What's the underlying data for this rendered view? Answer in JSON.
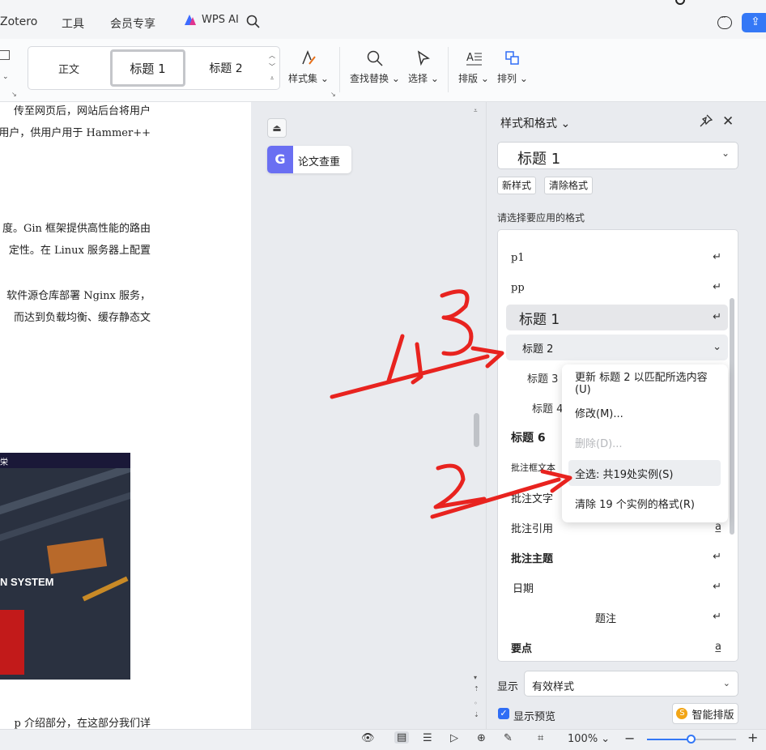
{
  "menubar": {
    "items": [
      "Zotero",
      "工具",
      "会员专享"
    ],
    "wps_ai": "WPS AI"
  },
  "ribbon": {
    "gallery": [
      "正文",
      "标题 1",
      "标题 2"
    ],
    "style_set": "样式集",
    "find_replace": "查找替换",
    "select": "选择",
    "layout": "排版",
    "arrange": "排列"
  },
  "document": {
    "lines": [
      "传至网页后，网站后台将用户",
      "用户，供用户用于 Hammer++",
      "度。Gin 框架提供高性能的路由",
      "定性。在 Linux 服务器上配置",
      "软件源仓库部署 Nginx 服务，",
      "而达到负载均衡、缓存静态文",
      "p 介绍部分，在这部分我们详"
    ],
    "image_top_text": "栄",
    "image_text": "N SYSTEM"
  },
  "plugin": {
    "chachong": "论文查重"
  },
  "panel": {
    "title": "样式和格式",
    "current_style": "标题 1",
    "new_style": "新样式",
    "clear_format": "清除格式",
    "hint": "请选择要应用的格式",
    "styles": [
      "p1",
      "pp",
      "标题 1",
      "标题 2",
      "标题 3",
      "标题 4",
      "标题 6",
      "批注框文本",
      "批注文字",
      "批注引用",
      "批注主题",
      "日期",
      "题注",
      "要点"
    ],
    "display_label": "显示",
    "display_value": "有效样式",
    "preview_label": "显示预览",
    "smart_layout": "智能排版"
  },
  "context_menu": {
    "items": [
      "更新 标题 2 以匹配所选内容(U)",
      "修改(M)...",
      "删除(D)...",
      "全选: 共19处实例(S)",
      "清除 19 个实例的格式(R)"
    ],
    "disabled_index": 2,
    "hover_index": 3
  },
  "statusbar": {
    "zoom": "100%",
    "zoom_fraction": 0.5
  },
  "annotations": {
    "color": "#e8231f",
    "marks": [
      "1、3",
      "2"
    ]
  }
}
